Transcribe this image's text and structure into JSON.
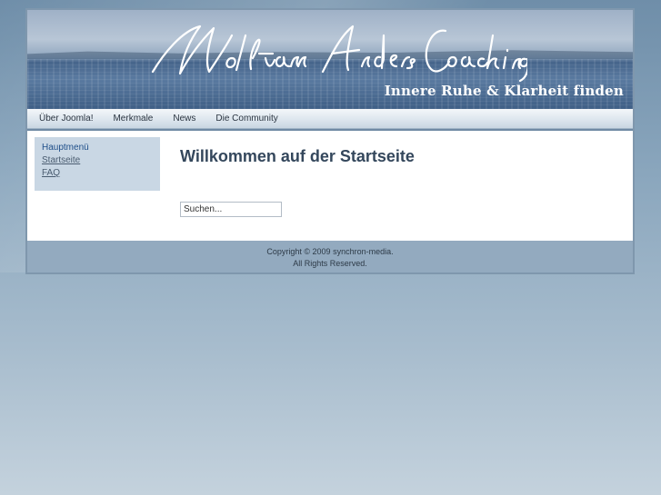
{
  "header": {
    "logo_text": "Wolfram Anders Coaching",
    "tagline": "Innere Ruhe & Klarheit finden"
  },
  "nav": {
    "items": [
      {
        "label": "Über Joomla!"
      },
      {
        "label": "Merkmale"
      },
      {
        "label": "News"
      },
      {
        "label": "Die Community"
      }
    ]
  },
  "sidebar": {
    "title": "Hauptmenü",
    "links": [
      {
        "label": "Startseite"
      },
      {
        "label": "FAQ"
      }
    ]
  },
  "main": {
    "title": "Willkommen auf der Startseite",
    "search": {
      "value": "Suchen..."
    }
  },
  "footer": {
    "copyright": "Copyright © 2009 synchron-media.",
    "rights": "All Rights Reserved."
  }
}
